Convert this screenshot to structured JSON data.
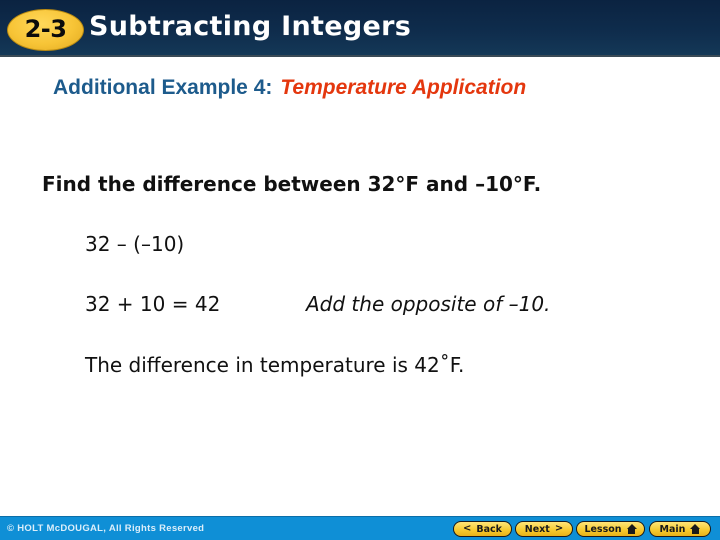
{
  "header": {
    "lesson_number": "2-3",
    "lesson_title": "Subtracting Integers",
    "colors": {
      "bar": "#0f2d4d",
      "badge": "#f7c436",
      "title": "#ffffff"
    }
  },
  "subtitle": {
    "label": "Additional Example 4:",
    "topic": "Temperature Application",
    "colors": {
      "label": "#1d5b8c",
      "topic": "#e4370e"
    }
  },
  "content": {
    "prompt": "Find the difference between 32°F and –10°F.",
    "step1": "32 – (–10)",
    "step2": "32 + 10 = 42",
    "step2_note": "Add the opposite of –10.",
    "conclusion": "The difference in temperature is 42˚F."
  },
  "footer": {
    "copyright": "© HOLT McDOUGAL, All Rights Reserved",
    "nav": {
      "back": {
        "label": "Back",
        "icon": "chevron-left-icon",
        "glyph": "<"
      },
      "next": {
        "label": "Next",
        "icon": "chevron-right-icon",
        "glyph": ">"
      },
      "lesson": {
        "label": "Lesson",
        "icon": "home-icon"
      },
      "main": {
        "label": "Main",
        "icon": "home-icon"
      }
    },
    "colors": {
      "bar": "#0f8fd6",
      "button": "#f6c92d"
    }
  }
}
